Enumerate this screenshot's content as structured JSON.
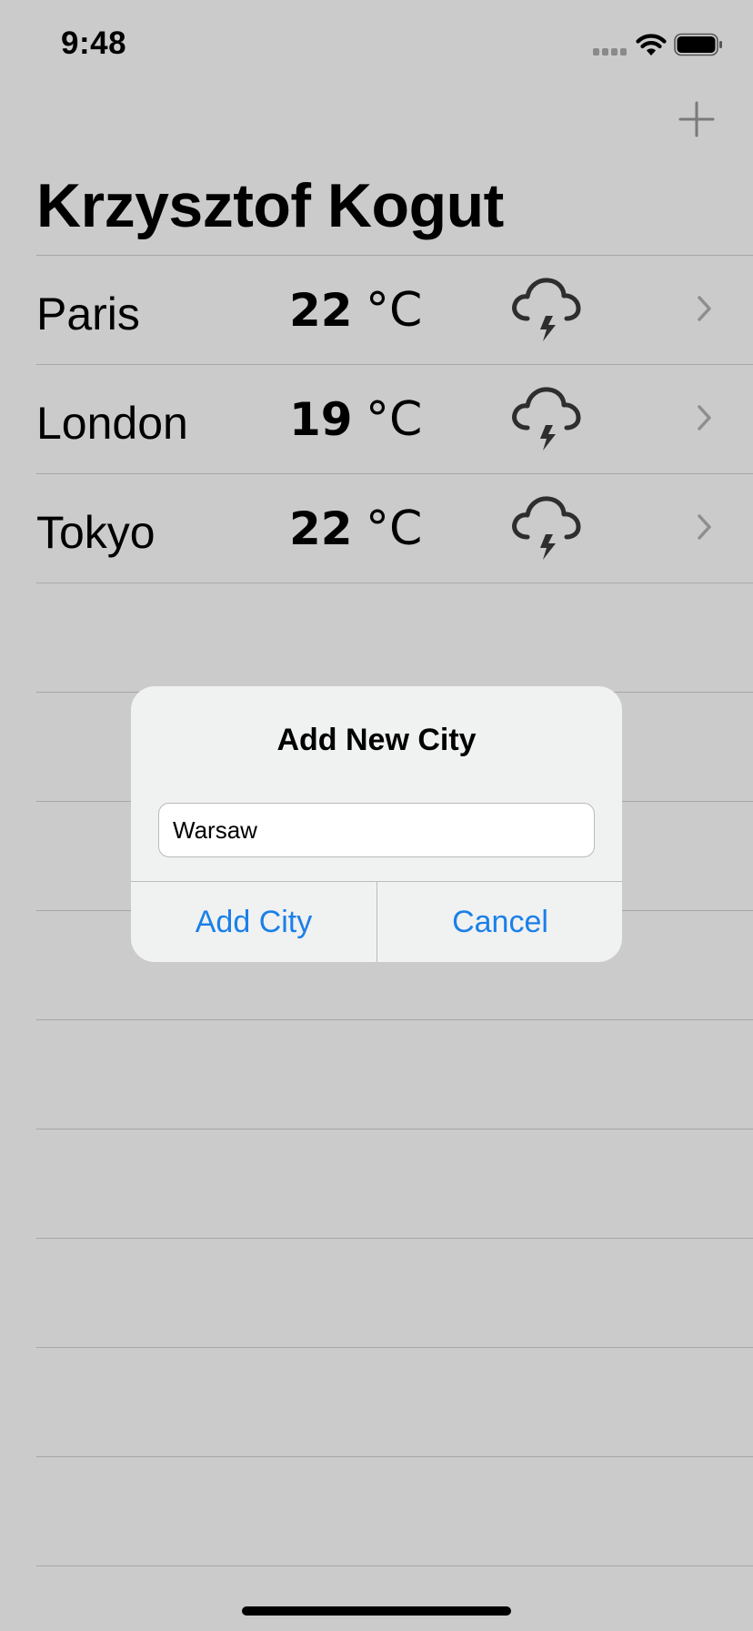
{
  "status_bar": {
    "time": "9:48"
  },
  "nav": {
    "add_icon": "plus-icon",
    "title": "Krzysztof Kogut"
  },
  "cities": [
    {
      "name": "Paris",
      "temp": "22",
      "unit": "°C",
      "icon": "thunderstorm-icon"
    },
    {
      "name": "London",
      "temp": "19",
      "unit": "°C",
      "icon": "thunderstorm-icon"
    },
    {
      "name": "Tokyo",
      "temp": "22",
      "unit": "°C",
      "icon": "thunderstorm-icon"
    }
  ],
  "alert": {
    "title": "Add New City",
    "input_value": "Warsaw",
    "add_label": "Add City",
    "cancel_label": "Cancel"
  },
  "colors": {
    "background": "#cbcbcb",
    "alert_background": "#f0f1f1",
    "accent": "#1a80e8",
    "separator": "#a7a7a7"
  }
}
